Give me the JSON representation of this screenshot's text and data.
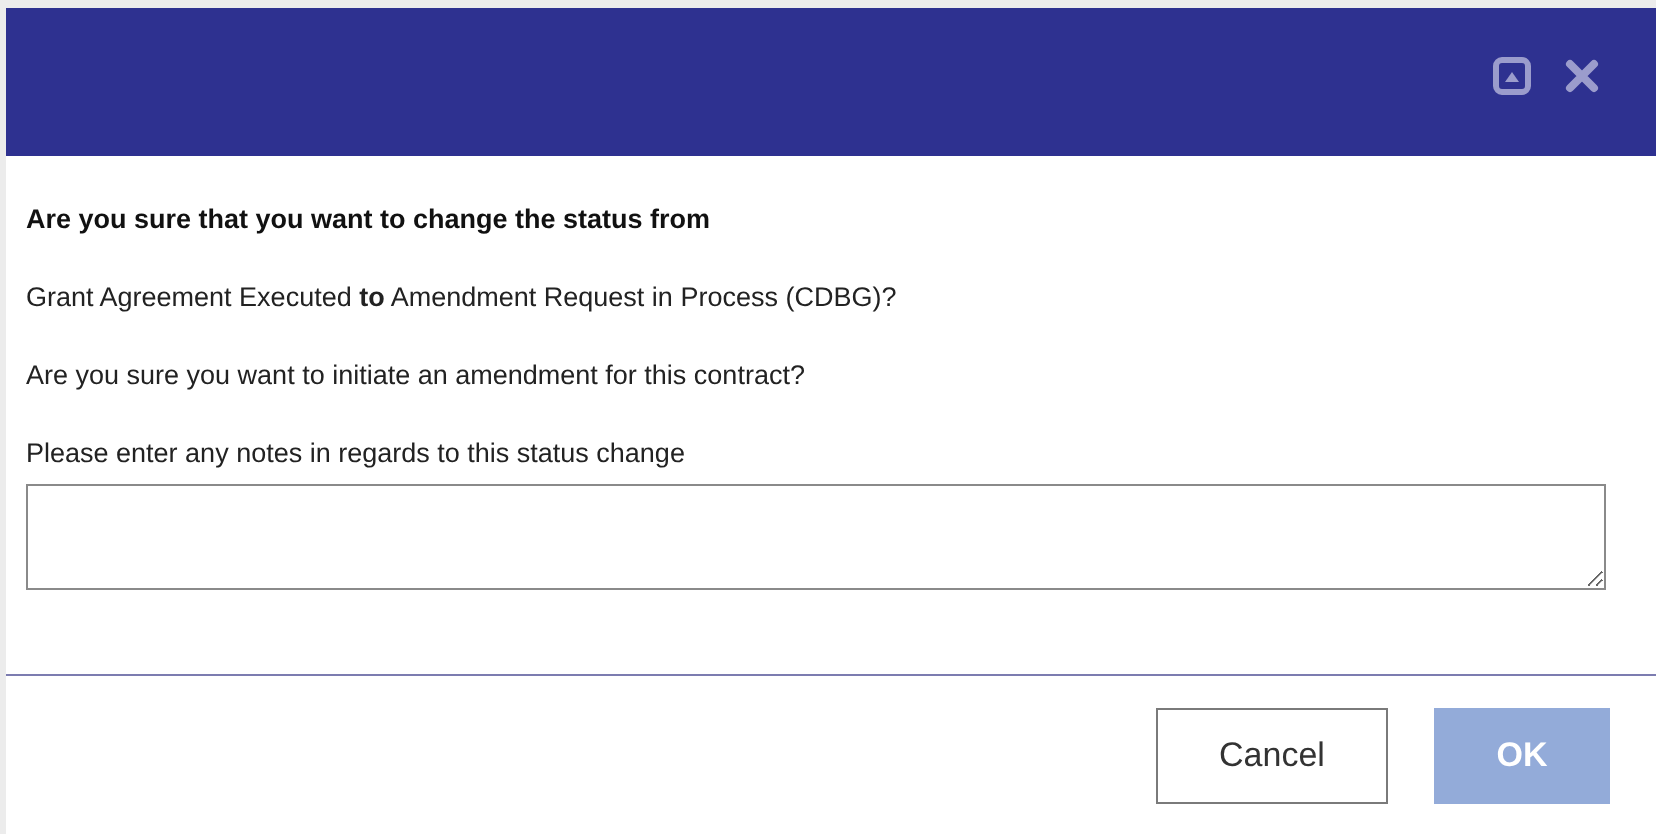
{
  "dialog": {
    "heading": "Are you sure that you want to change the status from",
    "transition": "Grant Agreement Executed **to** Amendment Request in Process (CDBG)?",
    "question": "Are you sure you want to initiate an amendment for this contract?",
    "notes_label": "Please enter any notes in regards to this status change",
    "buttons": [
      {
        "label": "Cancel",
        "kind": "secondary",
        "disabled": false
      },
      {
        "label": "OK",
        "kind": "primary",
        "disabled": true
      }
    ]
  }
}
